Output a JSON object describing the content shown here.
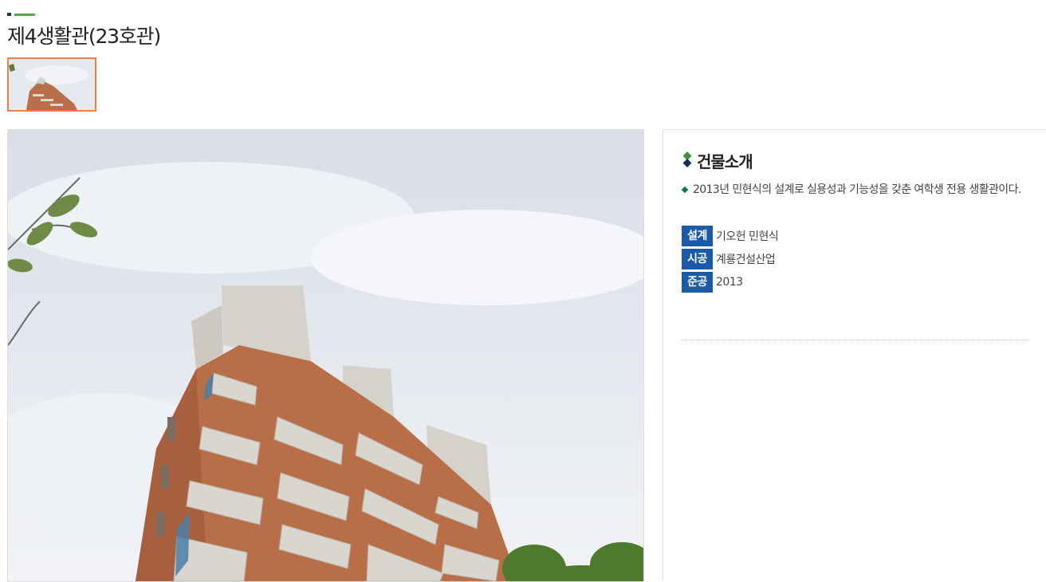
{
  "page": {
    "title": "제4생활관(23호관)"
  },
  "gallery": {
    "thumbnails": [
      {
        "selected": true
      }
    ]
  },
  "info": {
    "heading": "건물소개",
    "description": "2013년 민현식의 설계로 실용성과 기능성을 갖춘 여학생 전용 생활관이다.",
    "specs": [
      {
        "label": "설계",
        "value": "기오헌 민현식"
      },
      {
        "label": "시공",
        "value": "계룡건설산업"
      },
      {
        "label": "준공",
        "value": "2013"
      }
    ]
  },
  "colors": {
    "accent_green": "#4caf3b",
    "accent_navy": "#1a2f5e",
    "badge_blue": "#1a5aa6",
    "thumb_border": "#f07f4a",
    "bullet_green": "#0a7a44"
  }
}
